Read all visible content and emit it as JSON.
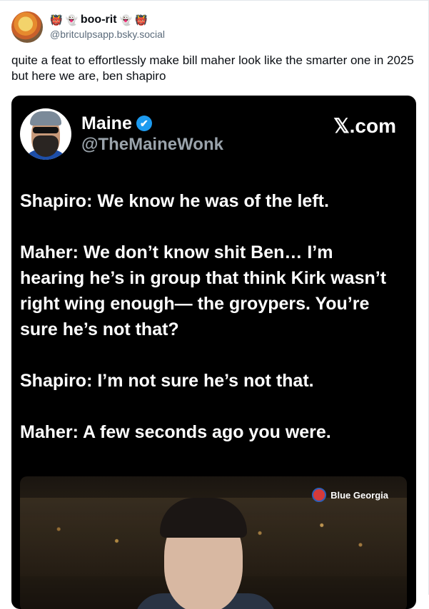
{
  "post": {
    "author": {
      "display_name": "boo-rit",
      "name_emojis_left": [
        "👹",
        "👻"
      ],
      "name_emojis_right": [
        "👻",
        "👹"
      ],
      "handle": "@britculpsapp.bsky.social"
    },
    "text": "quite a feat to effortlessly make bill maher look like the smarter one in 2025 but here we are, ben shapiro"
  },
  "embed": {
    "name": "Maine",
    "verified_icon": "✔",
    "handle": "@TheMaineWonk",
    "source": "𝕏.com",
    "lines": [
      "Shapiro: We know he was of the left.",
      "Maher: We don’t know shit Ben… I’m hearing  he’s in group that think Kirk wasn’t right wing enough— the groypers. You’re sure he’s not that?",
      "Shapiro: I’m not sure he’s not that.",
      "Maher: A few seconds ago you were."
    ],
    "video_badge": "Blue Georgia"
  }
}
